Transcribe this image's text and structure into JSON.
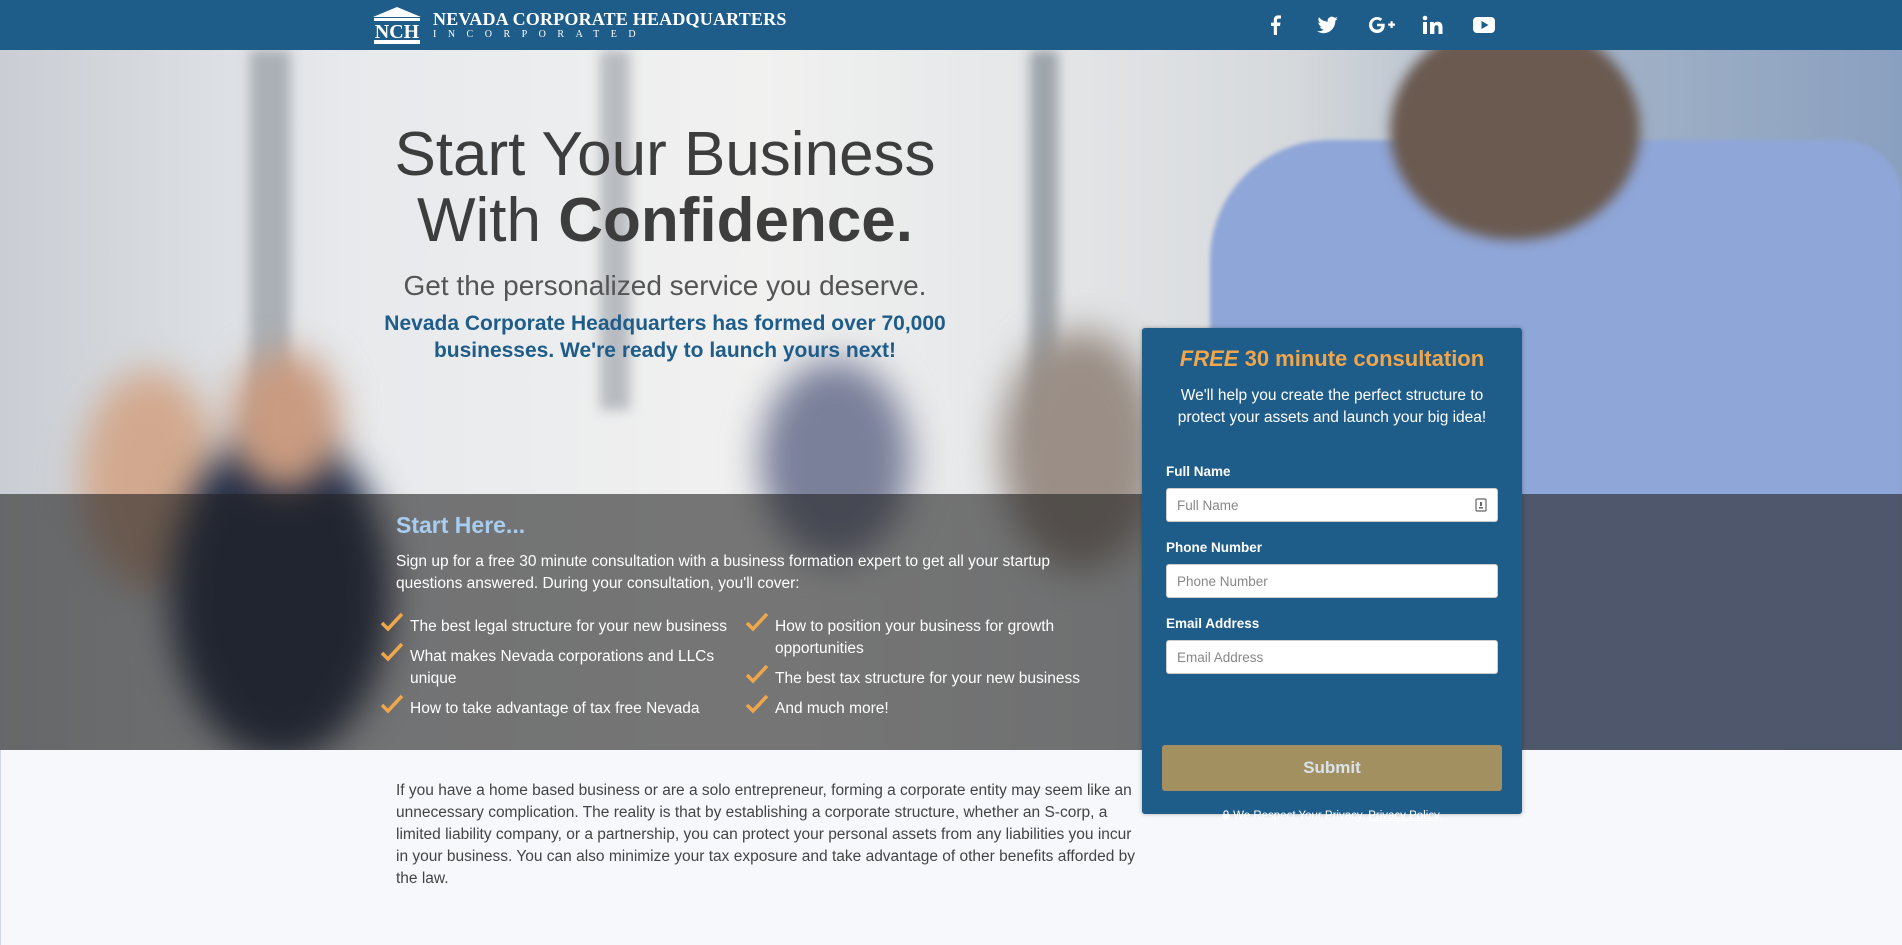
{
  "header": {
    "logo_mark": "NCH",
    "logo_line1": "NEVADA CORPORATE HEADQUARTERS",
    "logo_line2": "INCORPORATED",
    "social": [
      "facebook-icon",
      "twitter-icon",
      "google-plus-icon",
      "linkedin-icon",
      "youtube-icon"
    ]
  },
  "hero": {
    "headline_line1": "Start Your Business",
    "headline_with": "With ",
    "headline_bold": "Confidence.",
    "subheadline": "Get the personalized service you deserve.",
    "blurb": "Nevada Corporate Headquarters has formed over 70,000 businesses. We're ready to launch yours next!"
  },
  "start": {
    "title": "Start Here...",
    "intro": "Sign up for a free 30 minute consultation with a business formation expert to get all your startup questions answered. During your consultation, you'll cover:",
    "left_items": [
      "The best legal structure for your new business",
      "What makes Nevada corporations and LLCs unique",
      "How to take advantage of tax free Nevada"
    ],
    "right_items": [
      "How to position your business for growth opportunities",
      "The best tax structure for your new business",
      "And much more!"
    ]
  },
  "form": {
    "title_free": "FREE",
    "title_rest": " 30 minute consultation",
    "subtitle": "We'll help you create the perfect structure to protect your assets and launch your big idea!",
    "full_name_label": "Full Name",
    "full_name_placeholder": "Full Name",
    "phone_label": "Phone Number",
    "phone_placeholder": "Phone Number",
    "email_label": "Email Address",
    "email_placeholder": "Email Address",
    "submit_label": "Submit",
    "privacy_text": "We Respect Your Privacy.",
    "privacy_link": "Privacy Policy",
    "privacy_end": "."
  },
  "body": {
    "paragraph": "If you have a home based business or are a solo entrepreneur, forming a corporate entity may seem like an unnecessary complication. The reality is that by establishing a corporate structure, whether an S-corp, a limited liability company, or a partnership, you can protect your personal assets from any liabilities you incur in your business. You can also minimize your tax exposure and take advantage of other benefits afforded by the law."
  },
  "colors": {
    "brand_blue": "#1e5c8a",
    "accent_orange": "#f0a64b",
    "submit_gold": "#a39061",
    "start_title": "#a9cdf0"
  }
}
